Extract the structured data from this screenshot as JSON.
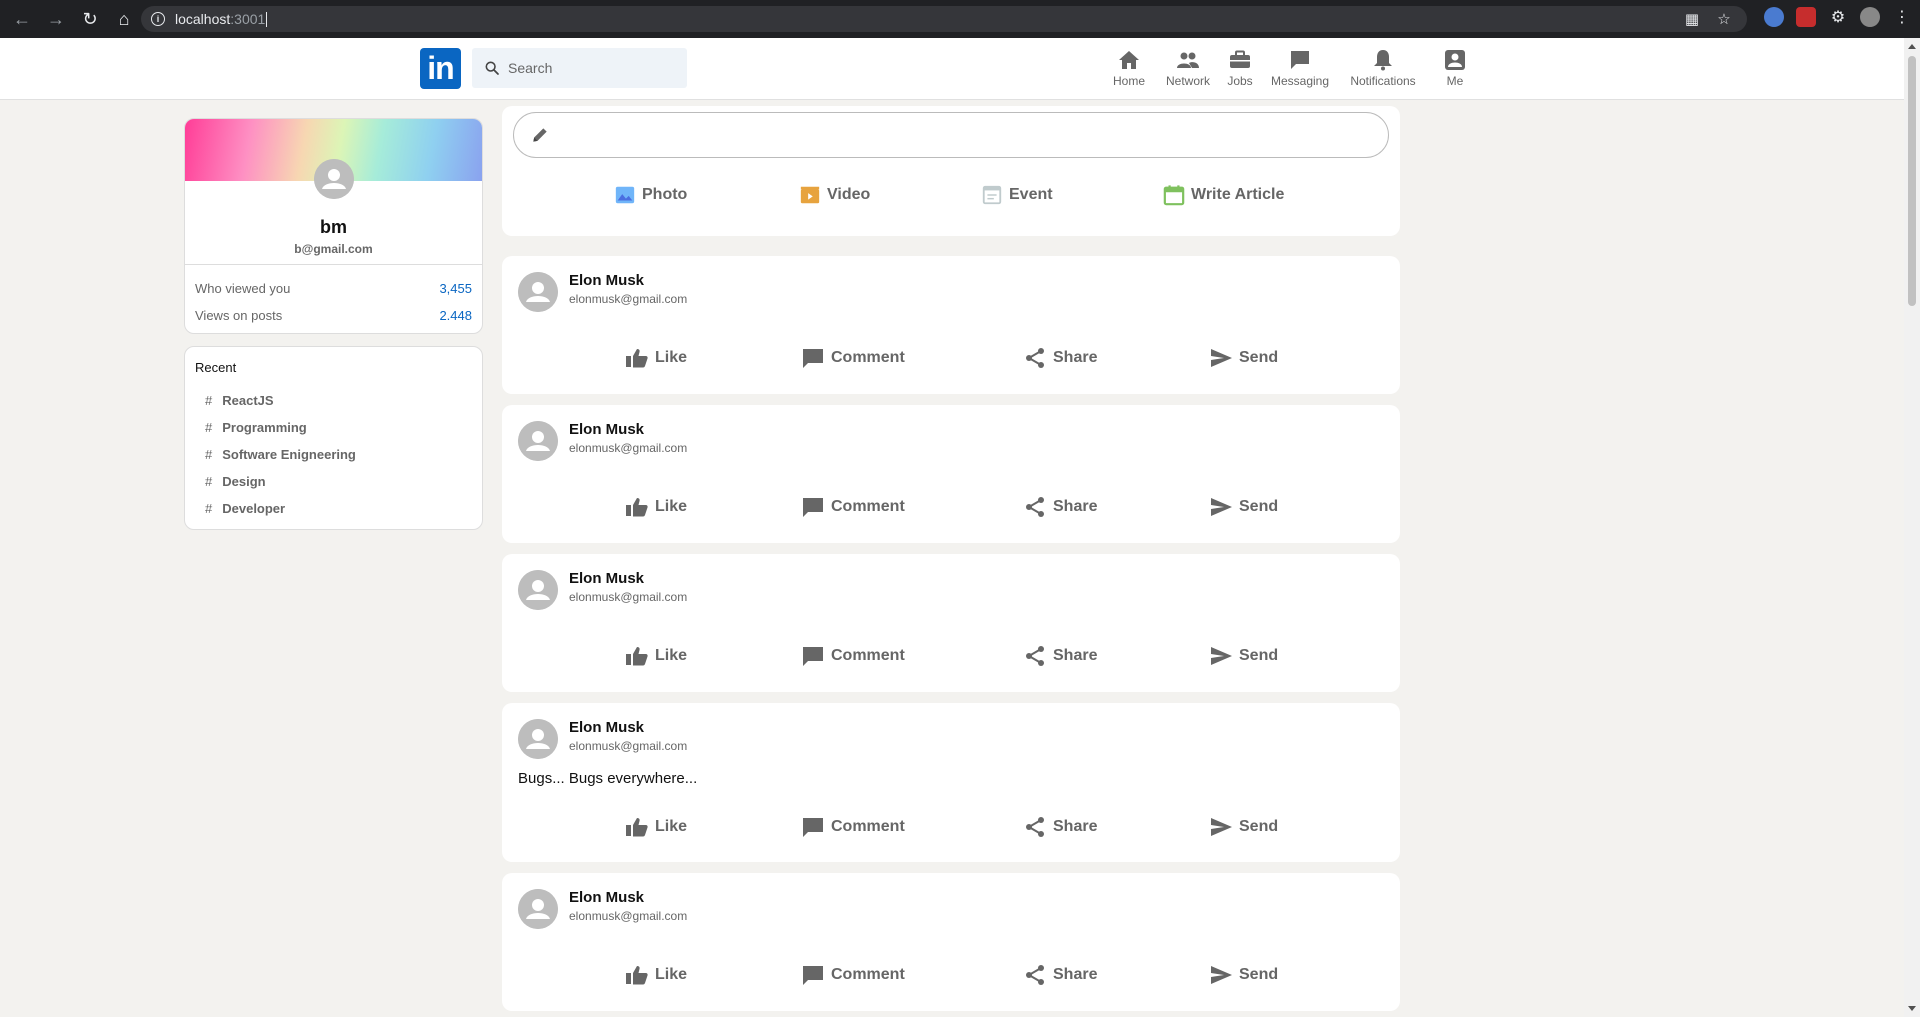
{
  "browser": {
    "url_host": "localhost",
    "url_port": ":3001"
  },
  "header": {
    "logo_text": "in",
    "search_placeholder": "Search",
    "nav": [
      {
        "label": "Home",
        "icon": "home-icon"
      },
      {
        "label": "Network",
        "icon": "network-icon"
      },
      {
        "label": "Jobs",
        "icon": "briefcase-icon"
      },
      {
        "label": "Messaging",
        "icon": "chat-icon"
      },
      {
        "label": "Notifications",
        "icon": "bell-icon"
      },
      {
        "label": "Me",
        "icon": "user-icon"
      }
    ]
  },
  "sidebar": {
    "profile": {
      "name": "bm",
      "email": "b@gmail.com"
    },
    "stats": [
      {
        "label": "Who viewed you",
        "value": "3,455"
      },
      {
        "label": "Views on posts",
        "value": "2.448"
      }
    ],
    "recent": {
      "title": "Recent",
      "items": [
        "ReactJS",
        "Programming",
        "Software Enigneering",
        "Design",
        "Developer"
      ]
    }
  },
  "composer": {
    "options": [
      {
        "label": "Photo",
        "icon": "photo-icon",
        "color": "#70b5f9"
      },
      {
        "label": "Video",
        "icon": "video-icon",
        "color": "#e7a33e"
      },
      {
        "label": "Event",
        "icon": "event-icon",
        "color": "#c0cbcd"
      },
      {
        "label": "Write Article",
        "icon": "article-icon",
        "color": "#7fc15e"
      }
    ]
  },
  "posts": [
    {
      "name": "Elon Musk",
      "email": "elonmusk@gmail.com",
      "message": ""
    },
    {
      "name": "Elon Musk",
      "email": "elonmusk@gmail.com",
      "message": ""
    },
    {
      "name": "Elon Musk",
      "email": "elonmusk@gmail.com",
      "message": ""
    },
    {
      "name": "Elon Musk",
      "email": "elonmusk@gmail.com",
      "message": "Bugs... Bugs everywhere..."
    },
    {
      "name": "Elon Musk",
      "email": "elonmusk@gmail.com",
      "message": ""
    }
  ],
  "post_actions": [
    {
      "label": "Like",
      "icon": "thumbs-up-icon"
    },
    {
      "label": "Comment",
      "icon": "comment-icon"
    },
    {
      "label": "Share",
      "icon": "share-icon"
    },
    {
      "label": "Send",
      "icon": "send-icon"
    }
  ],
  "colors": {
    "brand": "#0a66c2",
    "background": "#f3f2ef",
    "muted_text": "#666666"
  }
}
